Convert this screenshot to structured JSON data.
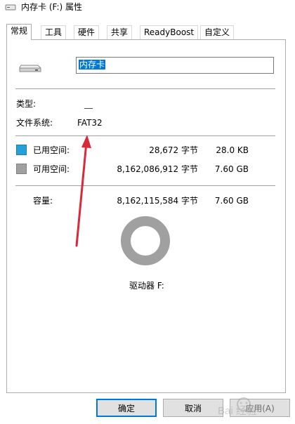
{
  "window": {
    "title": "内存卡 (F:) 属性"
  },
  "tabs": [
    {
      "label": "常规",
      "active": true
    },
    {
      "label": "工具"
    },
    {
      "label": "硬件"
    },
    {
      "label": "共享"
    },
    {
      "label": "ReadyBoost"
    },
    {
      "label": "自定义"
    }
  ],
  "general": {
    "name_value": "内存卡",
    "type_label": "类型:",
    "type_value": "__",
    "fs_label": "文件系统:",
    "fs_value": "FAT32",
    "used": {
      "label": "已用空间:",
      "bytes": "28,672 字节",
      "size": "28.0 KB",
      "color": "#26a0da"
    },
    "free": {
      "label": "可用空间:",
      "bytes": "8,162,086,912 字节",
      "size": "7.60 GB",
      "color": "#a0a0a0"
    },
    "capacity": {
      "label": "容量:",
      "bytes": "8,162,115,584 字节",
      "size": "7.60 GB"
    },
    "usage_fraction": 3.5e-06,
    "drive_label": "驱动器 F:"
  },
  "buttons": {
    "ok": "确定",
    "cancel": "取消",
    "apply": "应用(A)"
  },
  "annotation": {
    "arrow_color": "#d9293a"
  },
  "watermark": {
    "text": "Bai  经验"
  }
}
